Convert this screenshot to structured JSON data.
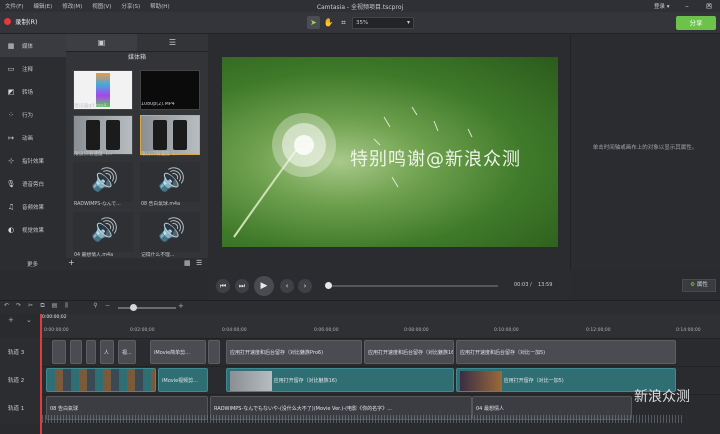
{
  "menu": [
    "文件(F)",
    "编辑(E)",
    "修改(M)",
    "视图(V)",
    "分享(S)",
    "帮助(H)"
  ],
  "window_title": "Camtasia - 全视频项目.tscproj",
  "login": "登录 ▾",
  "record_label": "录制(R)",
  "zoom_value": "35%",
  "share_label": "分享",
  "sidebar": [
    "媒体",
    "注释",
    "转场",
    "行为",
    "动画",
    "指针效果",
    "语音旁白",
    "音频效果",
    "视觉效果"
  ],
  "sidebar_more": "更多",
  "bin_title": "媒体箱",
  "bin_items": [
    "建设器gif.mp4",
    "1080p(2).MP4",
    "限议识限速度（...",
    "限议识限速度（...",
    "RADWIMPS-なんで...",
    "08 告白氣球.m4a",
    "04 最想情人.m4a",
    "记得什么不理..."
  ],
  "caption": "特别鸣谢@新浪众测",
  "props_text": "单击时间轴或画布上的对象以显示其属性。",
  "time_current": "00:03",
  "time_total": "13:59",
  "props_button": "属性",
  "playhead_time": "0:00:00;02",
  "ruler_ticks": [
    "0:00:00;00",
    "0:02:00;00",
    "0:04:00;00",
    "0:06:00;00",
    "0:08:00;00",
    "0:10:00;00",
    "0:12:00;00",
    "0:14:00;00"
  ],
  "tracks": [
    "轨道 3",
    "轨道 2",
    "轨道 1"
  ],
  "clips_t3": [
    "iMovie简单剪...",
    "应用打开速度和后台留存（对比魅族Pro6)",
    "应用打开速度和后台留存（对比魅族16)",
    "应用打开速度和后台留存（对比一加5)"
  ],
  "clips_t3_small": [
    "人",
    "视..."
  ],
  "clips_t2": [
    "iMovie视频剪...",
    "应用打开留存（对比魅族16)",
    "应用打开留存（对比一加5)"
  ],
  "clips_t1": [
    "08 告白氣球",
    "RADWIMPS-なんでもないや-(没什么大不了)(Movie Ver.)-(电影《你的名字》...",
    "04 最想情人"
  ],
  "watermark": "新 众测\n浪"
}
